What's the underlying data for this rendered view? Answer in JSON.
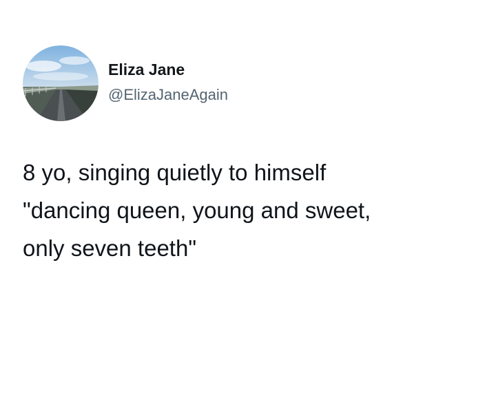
{
  "tweet": {
    "author": {
      "name": "Eliza Jane",
      "handle": "@ElizaJaneAgain",
      "avatar_icon": "avatar-photo-road-landscape"
    },
    "text_lines": [
      "8 yo, singing quietly to himself",
      "\"dancing queen, young and sweet,",
      "only seven teeth\""
    ]
  },
  "colors": {
    "background": "#ffffff",
    "name": "#14171a",
    "handle": "#536471",
    "text": "#0f1419"
  }
}
